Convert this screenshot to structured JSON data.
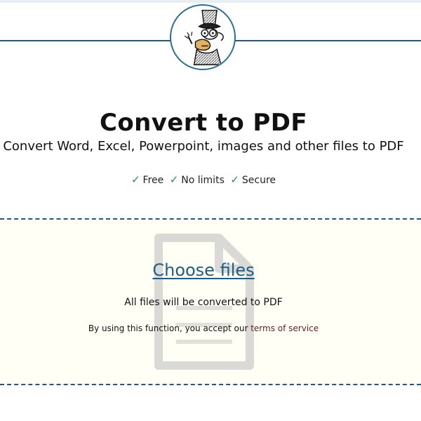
{
  "header": {
    "logo_icon": "converter-mascot-icon",
    "accent_color": "#1e5b80"
  },
  "main": {
    "title": "Convert to PDF",
    "subtitle": "Convert Word, Excel, Powerpoint, images and other files to PDF",
    "features": [
      {
        "icon": "check-icon",
        "symbol": "✓",
        "label": "Free"
      },
      {
        "icon": "check-icon",
        "symbol": "✓",
        "label": "No limits"
      },
      {
        "icon": "check-icon",
        "symbol": "✓",
        "label": "Secure"
      }
    ]
  },
  "dropzone": {
    "background_icon": "file-icon",
    "choose_files_label": "Choose files",
    "info_text": "All files will be converted to PDF",
    "terms_prefix": "By using this function, you accept our ",
    "terms_link_label": "terms of service"
  }
}
